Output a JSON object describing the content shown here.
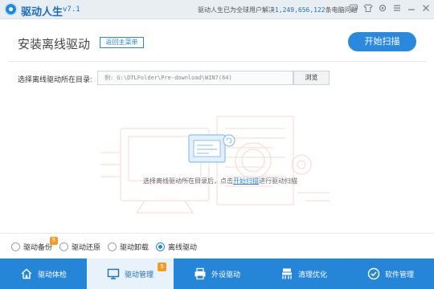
{
  "app": {
    "name": "驱动人生",
    "version": "v7.1",
    "slogan_prefix": "驱动人生已为全球用户解决",
    "slogan_count": "1,249,656,122",
    "slogan_suffix": "条电脑问题"
  },
  "titlebar_icons": [
    "message-icon",
    "tshirt-skin-icon",
    "settings-icon",
    "menu-icon",
    "minimize-icon",
    "close-icon"
  ],
  "header": {
    "title": "安装离线驱动",
    "back_label": "返回主菜单",
    "scan_label": "开始扫描"
  },
  "directory": {
    "label": "选择离线驱动所在目录:",
    "placeholder": "例: G:\\DTLFolder\\Pre-download\\WIN7(64)",
    "browse_label": "浏览"
  },
  "hint": {
    "before": "选择离线驱动所在目录后，点击",
    "link": "开始扫描",
    "after": "进行驱动扫描"
  },
  "options": [
    {
      "label": "驱动备份",
      "selected": false
    },
    {
      "label": "驱动还原",
      "selected": false
    },
    {
      "label": "驱动卸载",
      "selected": false
    },
    {
      "label": "离线驱动",
      "selected": true
    }
  ],
  "options_badge": "5",
  "nav": [
    {
      "label": "驱动体检",
      "icon": "home-icon",
      "active": false
    },
    {
      "label": "驱动管理",
      "icon": "monitor-icon",
      "active": true,
      "badge": "5"
    },
    {
      "label": "外设驱动",
      "icon": "printer-icon",
      "active": false
    },
    {
      "label": "清理优化",
      "icon": "clean-icon",
      "active": false
    },
    {
      "label": "软件管理",
      "icon": "software-icon",
      "active": false
    }
  ],
  "colors": {
    "accent": "#2b86d8",
    "nav_bg": "#2585d6",
    "badge": "#f59a23"
  }
}
